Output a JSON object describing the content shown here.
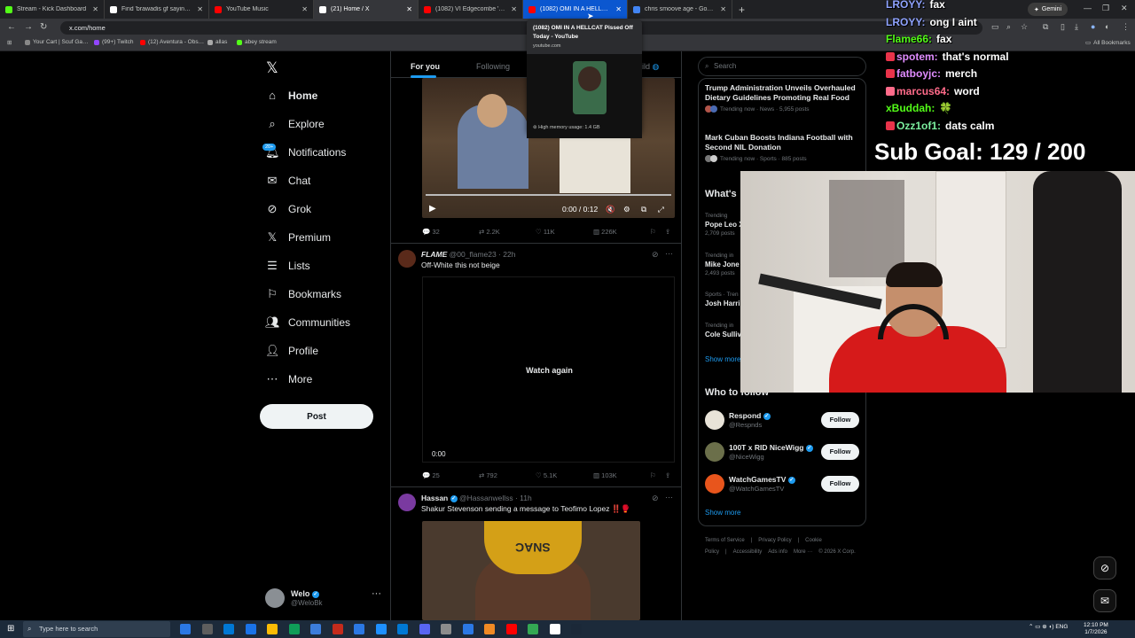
{
  "browser": {
    "tabs": [
      {
        "label": "Stream - Kick Dashboard",
        "color": "#53fc18"
      },
      {
        "label": "Find 'brawadis gf saying she n…",
        "color": "#ffffff"
      },
      {
        "label": "YouTube Music",
        "color": "#ff0000"
      },
      {
        "label": "(21) Home / X",
        "color": "#ffffff"
      },
      {
        "label": "(1082) VI Edgecombe 'The Futu…",
        "color": "#ff0000"
      },
      {
        "label": "(1082) OMI IN A HELLCAT Pisse…",
        "color": "#ff0000"
      },
      {
        "label": "chris smoove age - Google Sear…",
        "color": "#4285f4"
      }
    ],
    "new_tab": "+",
    "gemini": "Gemini",
    "url": "x.com/home",
    "bookmarks": [
      {
        "label": "Your Cart | Scuf Ga…",
        "color": "#888888"
      },
      {
        "label": "(99+) Twitch",
        "color": "#9146ff"
      },
      {
        "label": "(12) Aventura - Obs…",
        "color": "#ff0000"
      },
      {
        "label": "allas",
        "color": "#aaaaaa"
      },
      {
        "label": "abey stream",
        "color": "#53fc18"
      }
    ],
    "all_bookmarks": "All Bookmarks"
  },
  "tooltip": {
    "title": "(1082) OMI IN A HELLCAT Pissed Off Today - YouTube",
    "domain": "youtube.com",
    "memory": "High memory usage: 1.4 GB"
  },
  "sidebar": {
    "items": [
      {
        "label": "Home",
        "icon": "home-icon"
      },
      {
        "label": "Explore",
        "icon": "search-icon"
      },
      {
        "label": "Notifications",
        "icon": "bell-icon"
      },
      {
        "label": "Chat",
        "icon": "mail-icon"
      },
      {
        "label": "Grok",
        "icon": "grok-icon"
      },
      {
        "label": "Premium",
        "icon": "x-icon"
      },
      {
        "label": "Lists",
        "icon": "list-icon"
      },
      {
        "label": "Bookmarks",
        "icon": "bookmark-icon"
      },
      {
        "label": "Communities",
        "icon": "people-icon"
      },
      {
        "label": "Profile",
        "icon": "person-icon"
      },
      {
        "label": "More",
        "icon": "more-circle-icon"
      }
    ],
    "notif_badge": "20+",
    "post": "Post",
    "account": {
      "name": "Welo",
      "handle": "@WeloBk"
    }
  },
  "feed": {
    "tabs": [
      "For you",
      "Following"
    ],
    "partial_tab": "ild",
    "post1": {
      "time": "0:00 / 0:12",
      "replies": "32",
      "reposts": "2.2K",
      "likes": "11K",
      "views": "226K"
    },
    "post2": {
      "name": "FLAME",
      "handle": "@00_flame23",
      "age": "22h",
      "text": "Off-White this not beige",
      "overlay": "Watch again",
      "time": "0:00",
      "replies": "25",
      "reposts": "792",
      "likes": "5.1K",
      "views": "103K"
    },
    "post3": {
      "name": "Hassan",
      "handle": "@Hassanwellss",
      "age": "11h",
      "text": "Shakur Stevenson sending a message to Teofimo Lopez ‼️🥊",
      "hat": "SNAC"
    }
  },
  "right": {
    "search": "Search",
    "news": [
      {
        "headline": "Trump Administration Unveils Overhauled Dietary Guidelines Promoting Real Food",
        "meta": "Trending now · News · 5,955 posts"
      },
      {
        "headline": "Mark Cuban Boosts Indiana Football with Second NIL Donation",
        "meta": "Trending now · Sports · 885 posts"
      }
    ],
    "whats_happening": "What's",
    "trends": [
      {
        "ctx": "Trending",
        "name": "Pope Leo X",
        "posts": "2,709 posts"
      },
      {
        "ctx": "Trending in",
        "name": "Mike Jone",
        "posts": "2,493 posts"
      },
      {
        "ctx": "Sports · Tren",
        "name": "Josh Harri",
        "posts": ""
      },
      {
        "ctx": "Trending in",
        "name": "Cole Sulliv",
        "posts": ""
      }
    ],
    "show_more": "Show more",
    "who_to_follow": "Who to follow",
    "follows": [
      {
        "name": "Respond",
        "handle": "@Respnds",
        "color": "#e8e3d8"
      },
      {
        "name": "100T x RID NiceWigg",
        "handle": "@NiceWigg",
        "color": "#6b6f4a"
      },
      {
        "name": "WatchGamesTV",
        "handle": "@WatchGamesTV",
        "color": "#e8551c"
      }
    ],
    "follow_label": "Follow",
    "footer": [
      "Terms of Service",
      "|",
      "Privacy Policy",
      "|",
      "Cookie Policy",
      "|",
      "Accessibility",
      "Ads info",
      "More ···",
      "© 2026 X Corp."
    ]
  },
  "chat": [
    {
      "user": "LROYY:",
      "msg": "fax",
      "color": "#8fa3ff",
      "badge": ""
    },
    {
      "user": "LROYY:",
      "msg": "ong I aint",
      "color": "#8fa3ff",
      "badge": ""
    },
    {
      "user": "Flame66:",
      "msg": "fax",
      "color": "#53fc18",
      "badge": ""
    },
    {
      "user": "spotem:",
      "msg": "that's normal",
      "color": "#e08cff",
      "badge": "#e8334a"
    },
    {
      "user": "fatboyjc:",
      "msg": "merch",
      "color": "#e08cff",
      "badge": "#e8334a"
    },
    {
      "user": "marcus64:",
      "msg": "word",
      "color": "#ff6b8a",
      "badge": "#ff6b8a"
    },
    {
      "user": "xBuddah:",
      "msg": "🍀",
      "color": "#53fc18",
      "badge": ""
    },
    {
      "user": "Ozz1of1:",
      "msg": "dats calm",
      "color": "#7cf0a0",
      "badge": "#e8334a"
    }
  ],
  "sub_goal": "Sub Goal:  129 / 200",
  "taskbar": {
    "search": "Type here to search",
    "time": "12:10 PM",
    "date": "1/7/2026"
  }
}
